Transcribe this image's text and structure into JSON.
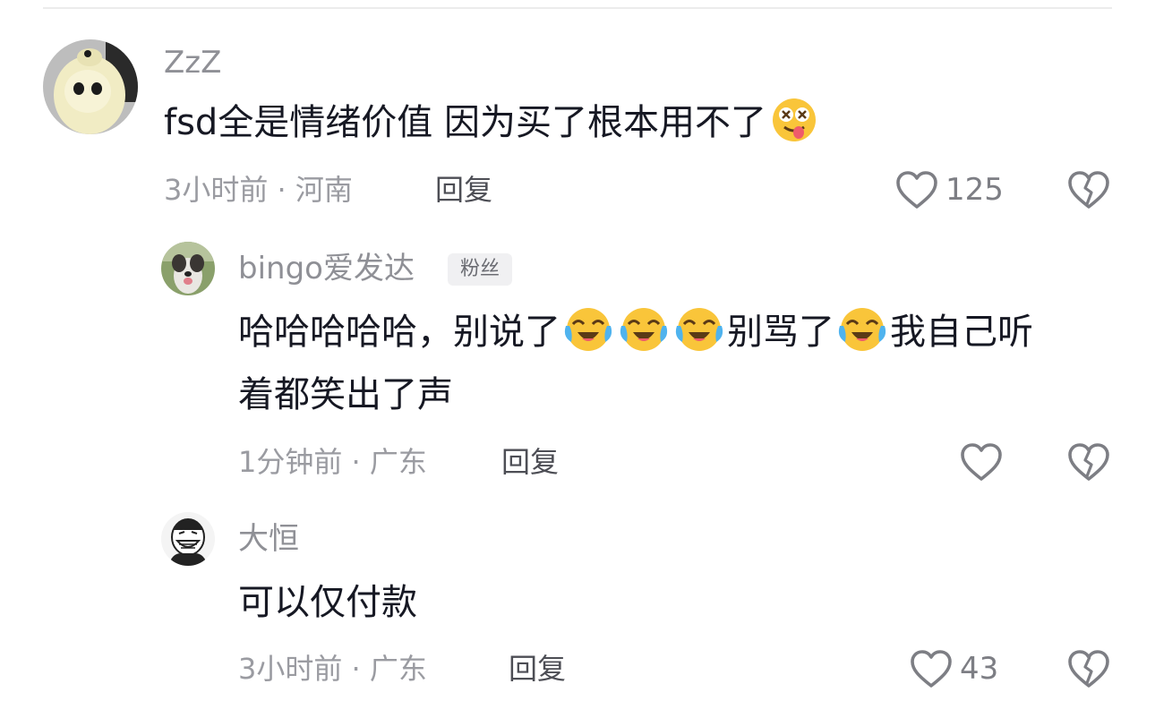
{
  "comments": [
    {
      "username": "ZzZ",
      "text_parts": [
        "fsd全是情绪价值 因为买了根本用不了"
      ],
      "emoji_trailing": "drooling-dizzy-face-emoji",
      "time": "3小时前",
      "location": "河南",
      "reply_label": "回复",
      "likes": "125"
    },
    {
      "username": "bingo爱发达",
      "badge": "粉丝",
      "text_line1_parts": [
        "哈哈哈哈哈，别说了",
        "别骂了",
        "我自己听"
      ],
      "text_line2": "着都笑出了声",
      "emoji_name": "crying-laughing-face-emoji",
      "time": "1分钟前",
      "location": "广东",
      "reply_label": "回复",
      "likes": ""
    },
    {
      "username": "大恒",
      "text": "可以仅付款",
      "time": "3小时前",
      "location": "广东",
      "reply_label": "回复",
      "likes": "43"
    }
  ],
  "meta_separator": " · ",
  "icons": {
    "like": "heart-outline-icon",
    "dislike": "broken-heart-icon"
  },
  "colors": {
    "text": "#161823",
    "meta": "#9a9ba1",
    "reply": "#4d4e55",
    "icon": "#7d7e84"
  }
}
